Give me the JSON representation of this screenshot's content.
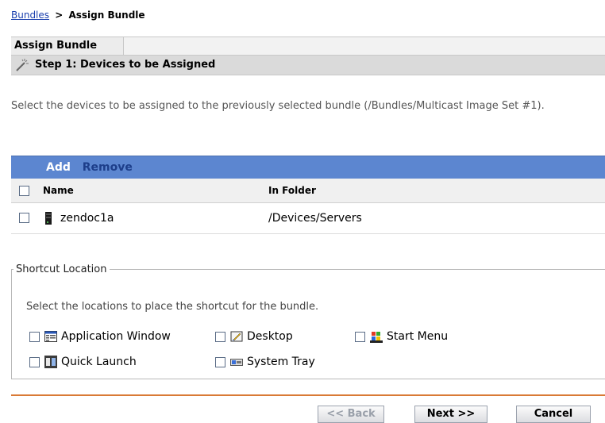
{
  "breadcrumb": {
    "link": "Bundles",
    "separator": ">",
    "current": "Assign Bundle"
  },
  "panel": {
    "tab_title": "Assign Bundle",
    "step_title": "Step 1: Devices to be Assigned"
  },
  "description": "Select the devices to be assigned to the previously selected bundle (/Bundles/Multicast Image Set #1).",
  "table": {
    "actions": {
      "add": "Add",
      "remove": "Remove"
    },
    "columns": {
      "name": "Name",
      "folder": "In Folder"
    },
    "rows": [
      {
        "name": "zendoc1a",
        "folder": "/Devices/Servers"
      }
    ]
  },
  "shortcut": {
    "legend": "Shortcut Location",
    "description": "Select the locations to place the shortcut for the bundle.",
    "options": {
      "app_window": "Application Window",
      "desktop": "Desktop",
      "start_menu": "Start Menu",
      "quick_launch": "Quick Launch",
      "system_tray": "System Tray"
    }
  },
  "buttons": {
    "back": "<< Back",
    "next": "Next >>",
    "cancel": "Cancel"
  },
  "colors": {
    "toolbar": "#5c86d0",
    "divider": "#d97a36",
    "link": "#1a3fae"
  }
}
